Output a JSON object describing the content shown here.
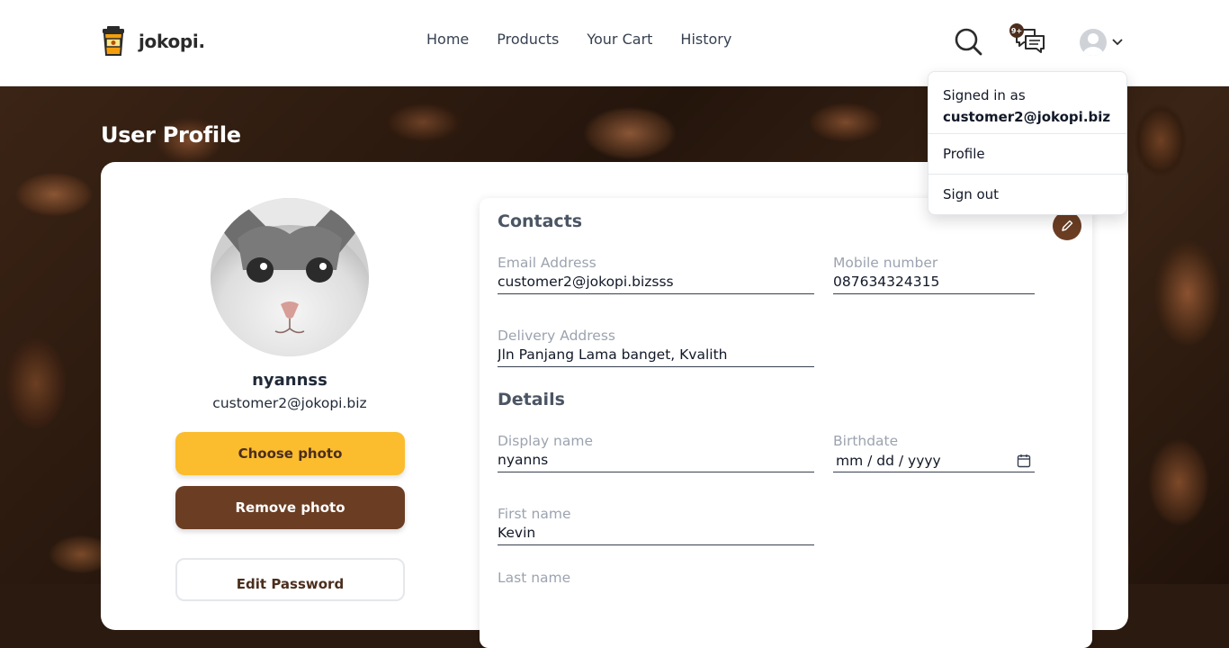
{
  "brand": {
    "name": "jokopi."
  },
  "nav": {
    "links": [
      "Home",
      "Products",
      "Your Cart",
      "History"
    ]
  },
  "notifications": {
    "badge": "9+"
  },
  "dropdown": {
    "signed_in_as": "Signed in as",
    "account_email": "customer2@jokopi.biz",
    "items": [
      "Profile",
      "Sign out"
    ]
  },
  "page": {
    "title": "User Profile"
  },
  "profile": {
    "username": "nyannss",
    "email": "customer2@jokopi.biz",
    "choose_photo": "Choose photo",
    "remove_photo": "Remove photo",
    "edit_password": "Edit Password"
  },
  "contacts": {
    "title": "Contacts",
    "email_label": "Email Address",
    "email_value": "customer2@jokopi.bizsss",
    "mobile_label": "Mobile number",
    "mobile_value": "087634324315",
    "address_label": "Delivery Address",
    "address_value": "Jln Panjang Lama banget, Kvalith"
  },
  "details": {
    "title": "Details",
    "display_name_label": "Display name",
    "display_name_value": "nyanns",
    "birthdate_label": "Birthdate",
    "birthdate_placeholder": "mm / dd / yyyy",
    "first_name_label": "First name",
    "first_name_value": "Kevin",
    "last_name_label": "Last name"
  },
  "colors": {
    "accent_yellow": "#fbbd2e",
    "accent_brown": "#6b3e24",
    "badge_brown": "#4b2e1d"
  }
}
